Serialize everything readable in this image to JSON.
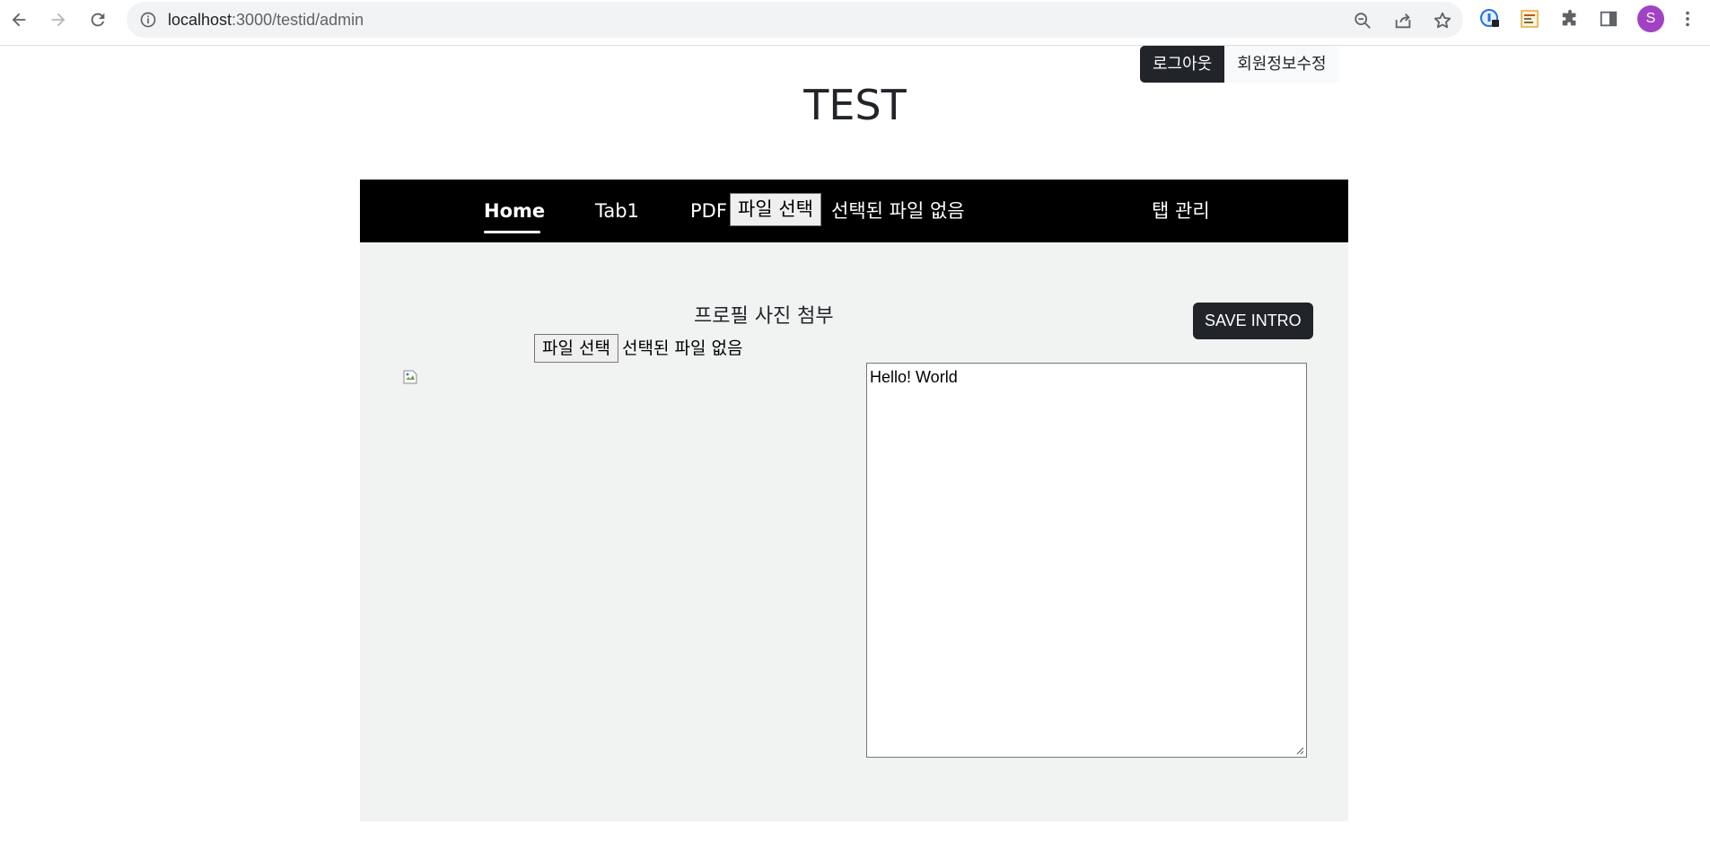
{
  "browser": {
    "url_host": "localhost",
    "url_path": ":3000/testid/admin",
    "avatar_letter": "S"
  },
  "header": {
    "logout_label": "로그아웃",
    "edit_profile_label": "회원정보수정",
    "site_title": "TEST"
  },
  "nav": {
    "items": [
      {
        "label": "Home",
        "active": true
      },
      {
        "label": "Tab1"
      },
      {
        "label": "PDF"
      }
    ],
    "file_button_label": "파일 선택",
    "file_status": "선택된 파일 없음",
    "manage_label": "탭 관리"
  },
  "main": {
    "profile_photo_label": "프로필 사진 첨부",
    "file_button_label": "파일 선택",
    "file_status": "선택된 파일 없음",
    "save_button_label": "SAVE INTRO",
    "intro_text": "Hello! World"
  },
  "colors": {
    "navbar_bg": "#000000",
    "panel_bg": "#f1f3f3",
    "dark_button": "#212529",
    "avatar_bg": "#a142c4"
  }
}
